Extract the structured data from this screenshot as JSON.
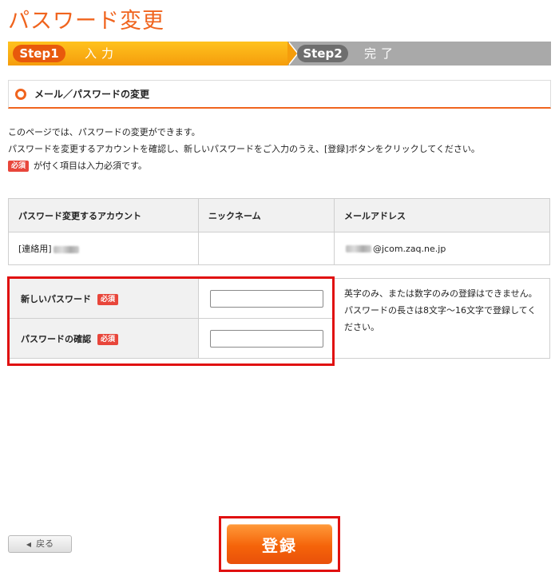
{
  "page": {
    "title": "パスワード変更"
  },
  "steps": [
    {
      "pill": "Step1",
      "label": "入力"
    },
    {
      "pill": "Step2",
      "label": "完了"
    }
  ],
  "section": {
    "title": "メール／パスワードの変更"
  },
  "description": {
    "line1": "このページでは、パスワードの変更ができます。",
    "line2": "パスワードを変更するアカウントを確認し、新しいパスワードをご入力のうえ、[登録]ボタンをクリックしてください。",
    "line3_suffix": "が付く項目は入力必須です。"
  },
  "required_badge": "必須",
  "account_table": {
    "headers": [
      "パスワード変更するアカウント",
      "ニックネーム",
      "メールアドレス"
    ],
    "row": {
      "account_prefix": "[連絡用]",
      "nickname": "",
      "email_suffix": "@jcom.zaq.ne.jp"
    }
  },
  "password_form": {
    "new_password_label": "新しいパスワード",
    "confirm_password_label": "パスワードの確認",
    "note": "英字のみ、または数字のみの登録はできません。パスワードの長さは8文字～16文字で登録してください。"
  },
  "buttons": {
    "back": "戻る",
    "submit": "登録"
  }
}
